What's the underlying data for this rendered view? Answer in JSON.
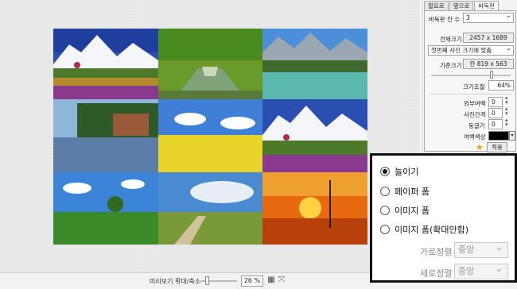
{
  "tabs": [
    "필요로",
    "옆으로",
    "바둑판"
  ],
  "settings": {
    "grid_count_label": "바둑판 칸 수",
    "grid_count_value": "3",
    "total_size_label": "전체크기",
    "total_size_value": "2457 x 1689",
    "fit_option": "첫번째 사진 크기에 맞춤",
    "base_size_label": "기준크기",
    "base_size_value": "칸 819 x 563",
    "scale_label": "크기조절",
    "scale_value": "64%",
    "outer_margin_label": "외부여백",
    "outer_margin_value": "0",
    "photo_gap_label": "사진간격",
    "photo_gap_value": "0",
    "rounding_label": "둥글기",
    "rounding_value": "0",
    "bg_color_label": "여백색상",
    "bg_color": "#000000",
    "apply_button": "적용"
  },
  "fill_options": {
    "options": [
      "늘이기",
      "페이퍼 폼",
      "이미지 폼",
      "이미지 폼(확대안함)"
    ],
    "selected": "늘이기",
    "h_align_label": "가로정렬",
    "h_align_value": "중앙",
    "v_align_label": "세로정렬",
    "v_align_value": "중앙"
  },
  "statusbar": {
    "zoom_label": "미리보기 확대/축소",
    "zoom_value": "26 %"
  }
}
